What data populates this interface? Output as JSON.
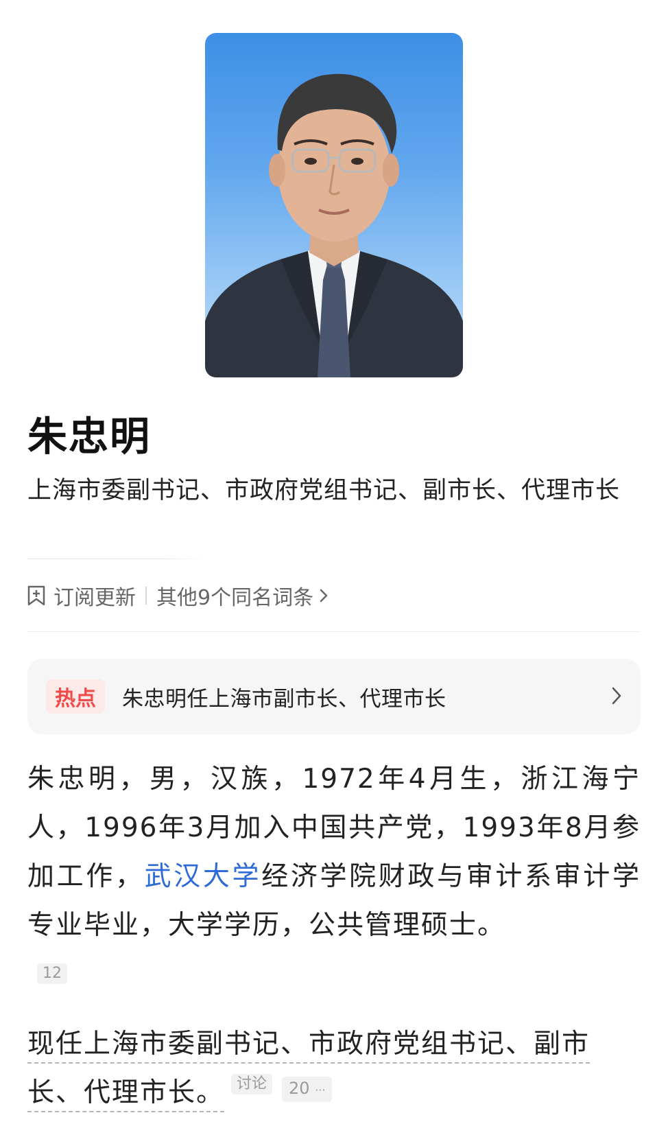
{
  "profile": {
    "photo_alt": "朱忠明 portrait",
    "name": "朱忠明",
    "subtitle": "上海市委副书记、市政府党组书记、副市长、代理市长"
  },
  "actions": {
    "subscribe_label": "订阅更新",
    "same_name_label": "其他9个同名词条"
  },
  "hot": {
    "badge": "热点",
    "headline": "朱忠明任上海市副市长、代理市长"
  },
  "bio": {
    "part1": "朱忠明，男，汉族，1972年4月生，浙江海宁人，1996年3月加入中国共产党，1993年8月参加工作，",
    "link": "武汉大学",
    "part2": "经济学院财政与审计系审计学专业毕业，大学学历，公共管理硕士。",
    "citation": "12"
  },
  "current": {
    "text": "现任上海市委副书记、市政府党组书记、副市长、代理市长。",
    "discuss_label": "讨论",
    "count": "20",
    "more": "···"
  },
  "colors": {
    "link": "#2f6bd6",
    "hot_badge_text": "#ef4b4b",
    "hot_badge_bg": "#fde9e8"
  },
  "icons": {
    "subscribe": "bookmark-plus-icon",
    "same_name": "chevron-right-icon",
    "hot": "chevron-right-icon"
  }
}
